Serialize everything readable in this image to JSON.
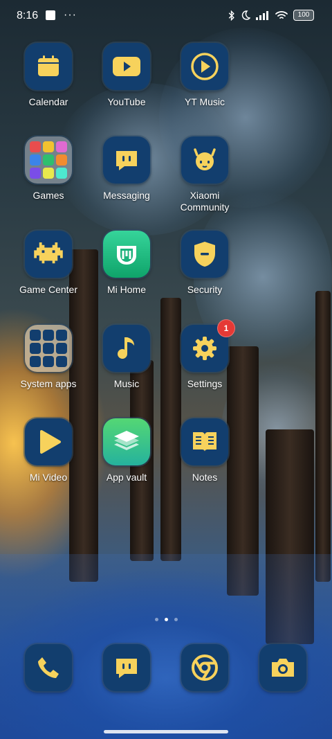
{
  "status_bar": {
    "time": "8:16",
    "battery": "100",
    "left_icons": [
      "screenshot-icon",
      "more-dots-icon"
    ],
    "right_icons": [
      "bluetooth-icon",
      "do-not-disturb-moon-icon",
      "signal-icon",
      "wifi-icon",
      "battery-icon"
    ]
  },
  "apps": [
    {
      "label": "Calendar",
      "icon": "calendar-icon"
    },
    {
      "label": "YouTube",
      "icon": "youtube-icon"
    },
    {
      "label": "YT Music",
      "icon": "yt-music-icon"
    },
    {
      "label": "Games",
      "icon": "games-folder-icon"
    },
    {
      "label": "Messaging",
      "icon": "messaging-icon"
    },
    {
      "label": "Xiaomi\nCommunity",
      "icon": "xiaomi-community-icon"
    },
    {
      "label": "Game Center",
      "icon": "game-center-icon"
    },
    {
      "label": "Mi Home",
      "icon": "mi-home-icon"
    },
    {
      "label": "Security",
      "icon": "security-shield-icon"
    },
    {
      "label": "System apps",
      "icon": "system-apps-folder-icon"
    },
    {
      "label": "Music",
      "icon": "music-note-icon"
    },
    {
      "label": "Settings",
      "icon": "settings-gear-icon",
      "badge": "1"
    },
    {
      "label": "Mi Video",
      "icon": "mi-video-play-icon"
    },
    {
      "label": "App vault",
      "icon": "app-vault-layers-icon"
    },
    {
      "label": "Notes",
      "icon": "notes-book-icon"
    }
  ],
  "dock": [
    {
      "icon": "phone-icon"
    },
    {
      "icon": "messaging-icon"
    },
    {
      "icon": "chrome-icon"
    },
    {
      "icon": "camera-icon"
    }
  ],
  "pages": {
    "count": 3,
    "active_index": 1
  },
  "colors": {
    "icon_bg": "#123e6e",
    "glyph": "#f7d25c",
    "badge": "#e53935"
  }
}
